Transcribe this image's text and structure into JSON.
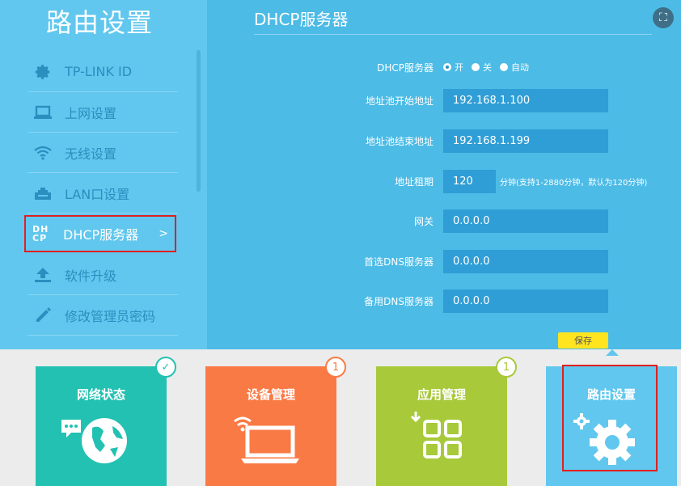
{
  "sidebar": {
    "title": "路由设置",
    "items": [
      {
        "label": "TP-LINK ID",
        "icon": "gear-icon"
      },
      {
        "label": "上网设置",
        "icon": "laptop-icon"
      },
      {
        "label": "无线设置",
        "icon": "wifi-icon"
      },
      {
        "label": "LAN口设置",
        "icon": "lan-icon"
      },
      {
        "label": "DHCP服务器",
        "icon": "dhcp-icon",
        "active": true,
        "arrow": ">"
      },
      {
        "label": "软件升级",
        "icon": "upload-icon"
      },
      {
        "label": "修改管理员密码",
        "icon": "pencil-icon"
      }
    ],
    "dhcp_icon_text": "DH CP"
  },
  "main": {
    "title": "DHCP服务器",
    "close_icon": "⛶",
    "dhcp_label": "DHCP服务器",
    "dhcp_options": [
      "开",
      "关",
      "自动"
    ],
    "dhcp_selected": "开",
    "pool_start_label": "地址池开始地址",
    "pool_start_value": "192.168.1.100",
    "pool_end_label": "地址池结束地址",
    "pool_end_value": "192.168.1.199",
    "lease_label": "地址租期",
    "lease_value": "120",
    "lease_note": "分钟(支持1-2880分钟，默认为120分钟)",
    "gateway_label": "网关",
    "gateway_value": "0.0.0.0",
    "dns1_label": "首选DNS服务器",
    "dns1_value": "0.0.0.0",
    "dns2_label": "备用DNS服务器",
    "dns2_value": "0.0.0.0",
    "save_label": "保存"
  },
  "tiles": [
    {
      "label": "网络状态",
      "color": "#23c1b2",
      "badge": "✓",
      "badge_color": "#23c1b2"
    },
    {
      "label": "设备管理",
      "color": "#fa7a45",
      "badge": "1",
      "badge_color": "#fa7a45"
    },
    {
      "label": "应用管理",
      "color": "#a7c93a",
      "badge": "1",
      "badge_color": "#a7c93a"
    },
    {
      "label": "路由设置",
      "color": "#61c7ee"
    }
  ]
}
